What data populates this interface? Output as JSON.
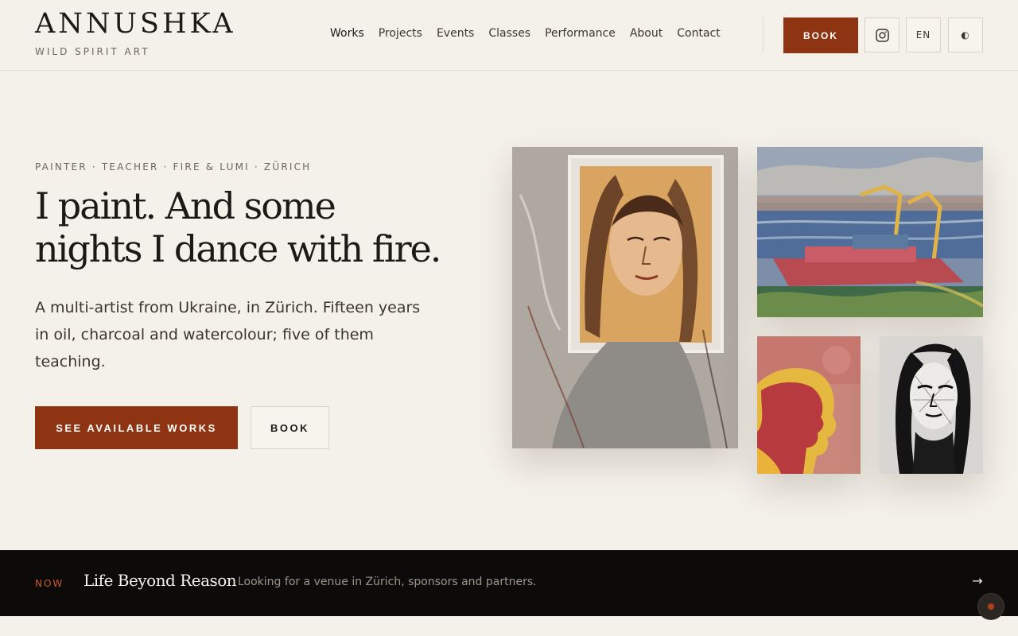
{
  "header": {
    "logo": "ANNUSHKA",
    "tagline": "WILD SPIRIT ART",
    "nav": [
      {
        "label": "Works"
      },
      {
        "label": "Projects"
      },
      {
        "label": "Events"
      },
      {
        "label": "Classes"
      },
      {
        "label": "Performance"
      },
      {
        "label": "About"
      },
      {
        "label": "Contact"
      }
    ],
    "book_label": "BOOK",
    "instagram_icon": "instagram-icon",
    "language": "EN",
    "theme_icon": "◐"
  },
  "hero": {
    "kicker": "PAINTER · TEACHER · FIRE & LUMI · ZÜRICH",
    "headline_line1": "I paint. And some",
    "headline_line2": "nights I dance with fire.",
    "intro": "A multi-artist from Ukraine, in Zürich. Fifteen years in oil, charcoal and watercolour; five of them teaching.",
    "primary_cta": "SEE AVAILABLE WORKS",
    "secondary_cta": "BOOK"
  },
  "gallery": [
    {
      "subject": "charcoal portrait of a woman"
    },
    {
      "subject": "harbour with cranes, oil"
    },
    {
      "subject": "red profile silhouette on yellow"
    },
    {
      "subject": "ink portrait of a woman"
    }
  ],
  "now_bar": {
    "label": "NOW",
    "title": "Life Beyond Reason",
    "text": "Looking for a venue in Zürich, sponsors and partners.",
    "arrow": "→"
  },
  "colors": {
    "accent": "#8e3412",
    "background": "#f4f1ea",
    "dark": "#0d0b0a"
  }
}
